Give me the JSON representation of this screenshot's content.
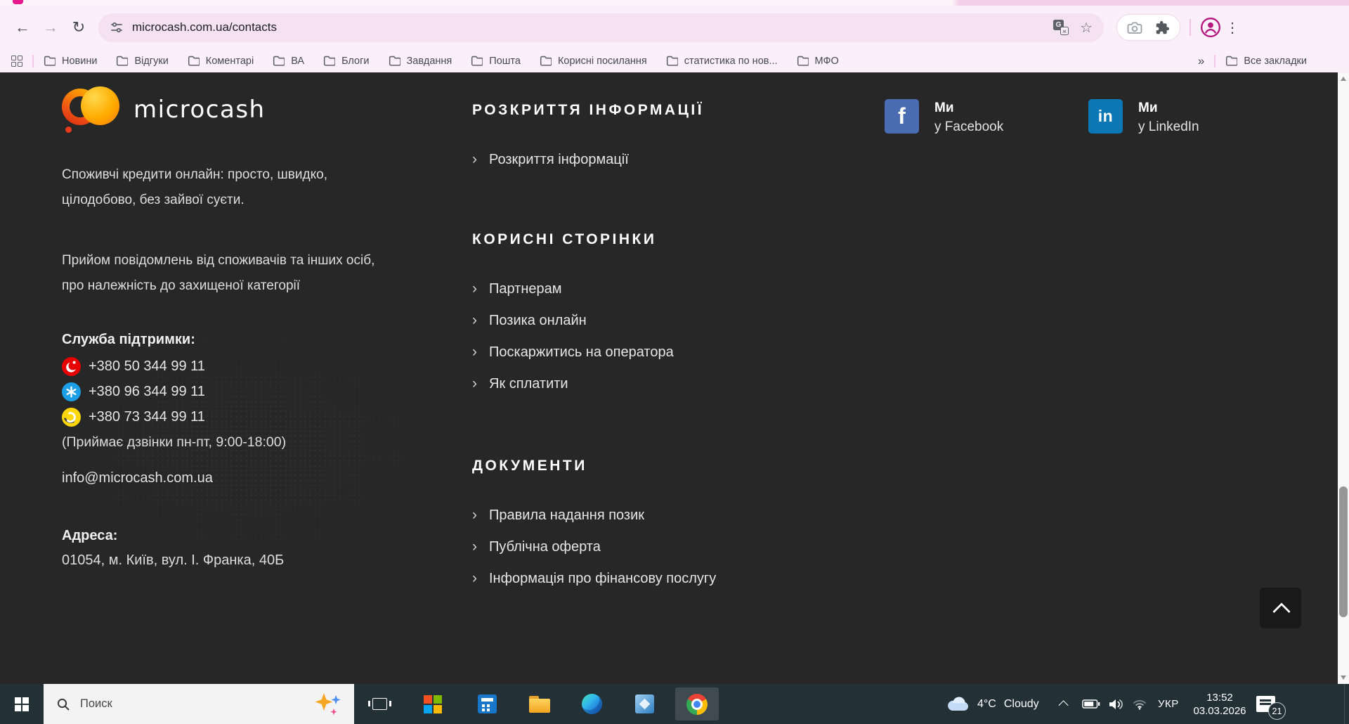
{
  "glyphs": {
    "back": "←",
    "forward": "→",
    "reload": "↻",
    "star": "☆",
    "menu": "⋮",
    "overflow": "»",
    "link_chevron": "›",
    "translate_main": "G",
    "translate_small": "ж"
  },
  "browser": {
    "url": "microcash.com.ua/contacts",
    "bookmarks": [
      "Новини",
      "Відгуки",
      "Коментарі",
      "ВА",
      "Блоги",
      "Завдання",
      "Пошта",
      "Корисні посилання",
      "статистика по нов...",
      "МФО"
    ],
    "all_bookmarks_label": "Все закладки"
  },
  "page": {
    "brand": "microcash",
    "tagline": "Споживчі кредити онлайн: просто, швидко, цілодобово, без зайвої суєти.",
    "notice": "Прийом повідомлень від споживачів та інших осіб, про належність до захищеної категорії",
    "support_label": "Служба підтримки:",
    "phones": [
      {
        "number": "+380 50 344 99 11"
      },
      {
        "number": "+380 96 344 99 11"
      },
      {
        "number": "+380 73 344 99 11"
      }
    ],
    "hours": "(Приймає дзвінки пн-пт, 9:00-18:00)",
    "email": "info@microcash.com.ua",
    "address_label": "Адреса:",
    "address": "01054, м. Київ, вул. І. Франка, 40Б",
    "sections": [
      {
        "title": "РОЗКРИТТЯ ІНФОРМАЦІЇ",
        "links": [
          "Розкриття інформації"
        ]
      },
      {
        "title": "КОРИСНІ СТОРІНКИ",
        "links": [
          "Партнерам",
          "Позика онлайн",
          "Поскаржитись на оператора",
          "Як сплатити"
        ]
      },
      {
        "title": "ДОКУМЕНТИ",
        "links": [
          "Правила надання позик",
          "Публічна оферта",
          "Інформація про фінансову послугу"
        ]
      }
    ],
    "social": [
      {
        "glyph": "f",
        "line1": "Ми",
        "line2": "у Facebook"
      },
      {
        "glyph": "in",
        "line1": "Ми",
        "line2": "у LinkedIn"
      }
    ],
    "colors": {
      "background": "#272727",
      "facebook": "#4a6cb3",
      "linkedin": "#0b77b5",
      "vodafone": "#e60000",
      "kyivstar": "#1ba0e8",
      "lifecell": "#ffd60a",
      "logo_orange": "#ff9500",
      "logo_red": "#e23414"
    }
  },
  "taskbar": {
    "search_text": "Поиск",
    "weather_temp": "4°C",
    "weather_condition": "Cloudy",
    "language": "УКР",
    "time": "13:52",
    "date": "03.03.2026",
    "notification_count": "21"
  }
}
